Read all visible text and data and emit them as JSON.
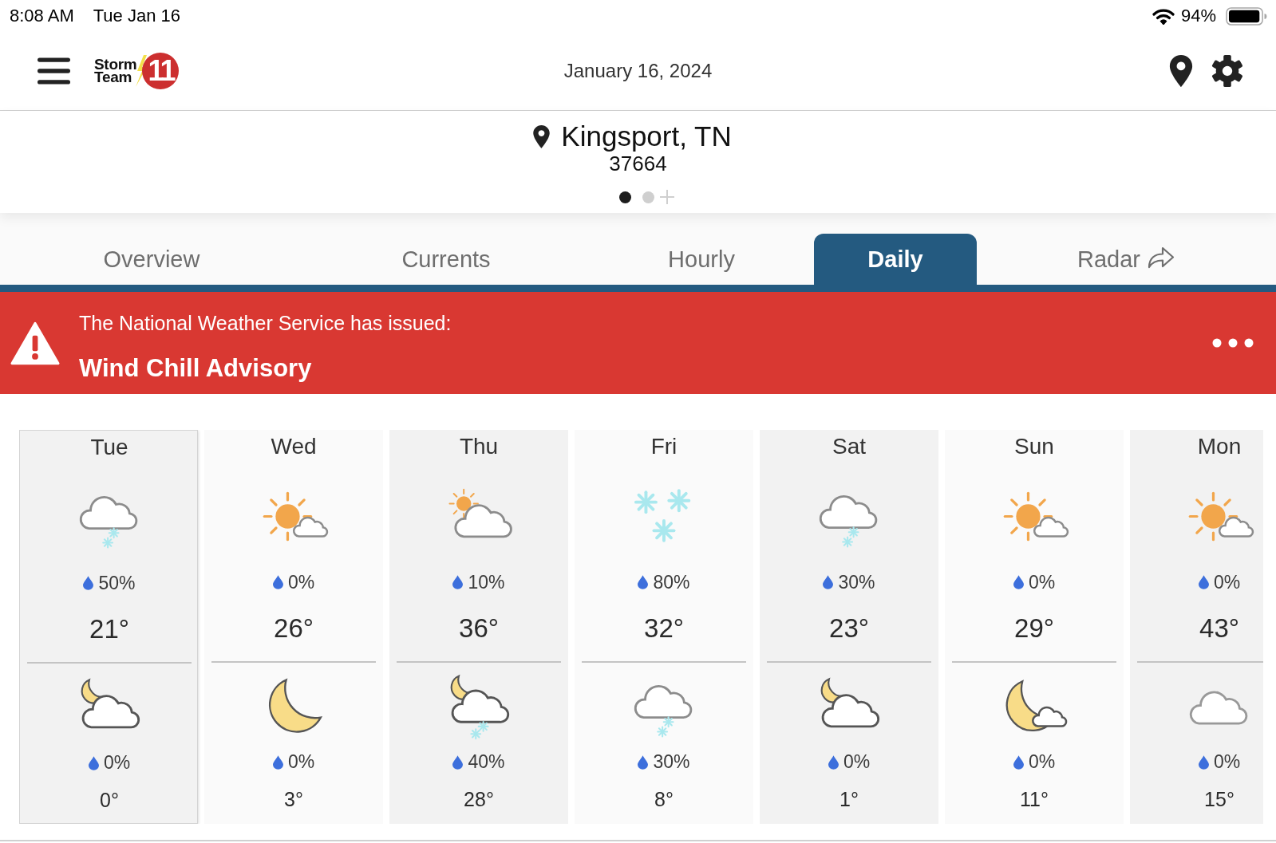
{
  "status_bar": {
    "time": "8:08 AM",
    "date": "Tue Jan 16",
    "battery": "94%"
  },
  "header": {
    "logo": {
      "line_1": "Storm",
      "line_2": "Team",
      "number": "11"
    },
    "date": "January 16, 2024"
  },
  "location": {
    "name": "Kingsport, TN",
    "zip": "37664",
    "pages": [
      {
        "selected": true
      },
      {
        "selected": false
      }
    ]
  },
  "tabs": [
    {
      "label": "Overview",
      "kind": "plain",
      "selected": false
    },
    {
      "label": "Currents",
      "kind": "plain",
      "selected": false
    },
    {
      "label": "Hourly",
      "kind": "plain",
      "selected": false
    },
    {
      "label": "Daily",
      "kind": "plain",
      "selected": true
    },
    {
      "label": "Radar",
      "kind": "external",
      "selected": false
    }
  ],
  "alert": {
    "intro": "The National Weather Service has issued:",
    "title": "Wind Chill Advisory"
  },
  "days": [
    {
      "day": "Tue",
      "selected": true,
      "daytime": {
        "kind": "snow-shower",
        "precip": "50%",
        "temp": "21°"
      },
      "overnight": {
        "kind": "partly-cloudy-night",
        "precip": "0%",
        "temp": "0°"
      }
    },
    {
      "day": "Wed",
      "selected": false,
      "daytime": {
        "kind": "mostly-sunny",
        "precip": "0%",
        "temp": "26°"
      },
      "overnight": {
        "kind": "clear-night",
        "precip": "0%",
        "temp": "3°"
      }
    },
    {
      "day": "Thu",
      "selected": false,
      "daytime": {
        "kind": "partly-cloudy",
        "precip": "10%",
        "temp": "36°"
      },
      "overnight": {
        "kind": "snow-shower-night",
        "precip": "40%",
        "temp": "28°"
      }
    },
    {
      "day": "Fri",
      "selected": false,
      "daytime": {
        "kind": "snow",
        "precip": "80%",
        "temp": "32°"
      },
      "overnight": {
        "kind": "snow-shower",
        "precip": "30%",
        "temp": "8°"
      }
    },
    {
      "day": "Sat",
      "selected": false,
      "daytime": {
        "kind": "snow-shower",
        "precip": "30%",
        "temp": "23°"
      },
      "overnight": {
        "kind": "partly-cloudy-night",
        "precip": "0%",
        "temp": "1°"
      }
    },
    {
      "day": "Sun",
      "selected": false,
      "daytime": {
        "kind": "mostly-sunny",
        "precip": "0%",
        "temp": "29°"
      },
      "overnight": {
        "kind": "mostly-clear-night",
        "precip": "0%",
        "temp": "11°"
      }
    },
    {
      "day": "Mon",
      "selected": false,
      "daytime": {
        "kind": "mostly-sunny",
        "precip": "0%",
        "temp": "43°"
      },
      "overnight": {
        "kind": "cloudy",
        "precip": "0%",
        "temp": "15°"
      }
    }
  ]
}
